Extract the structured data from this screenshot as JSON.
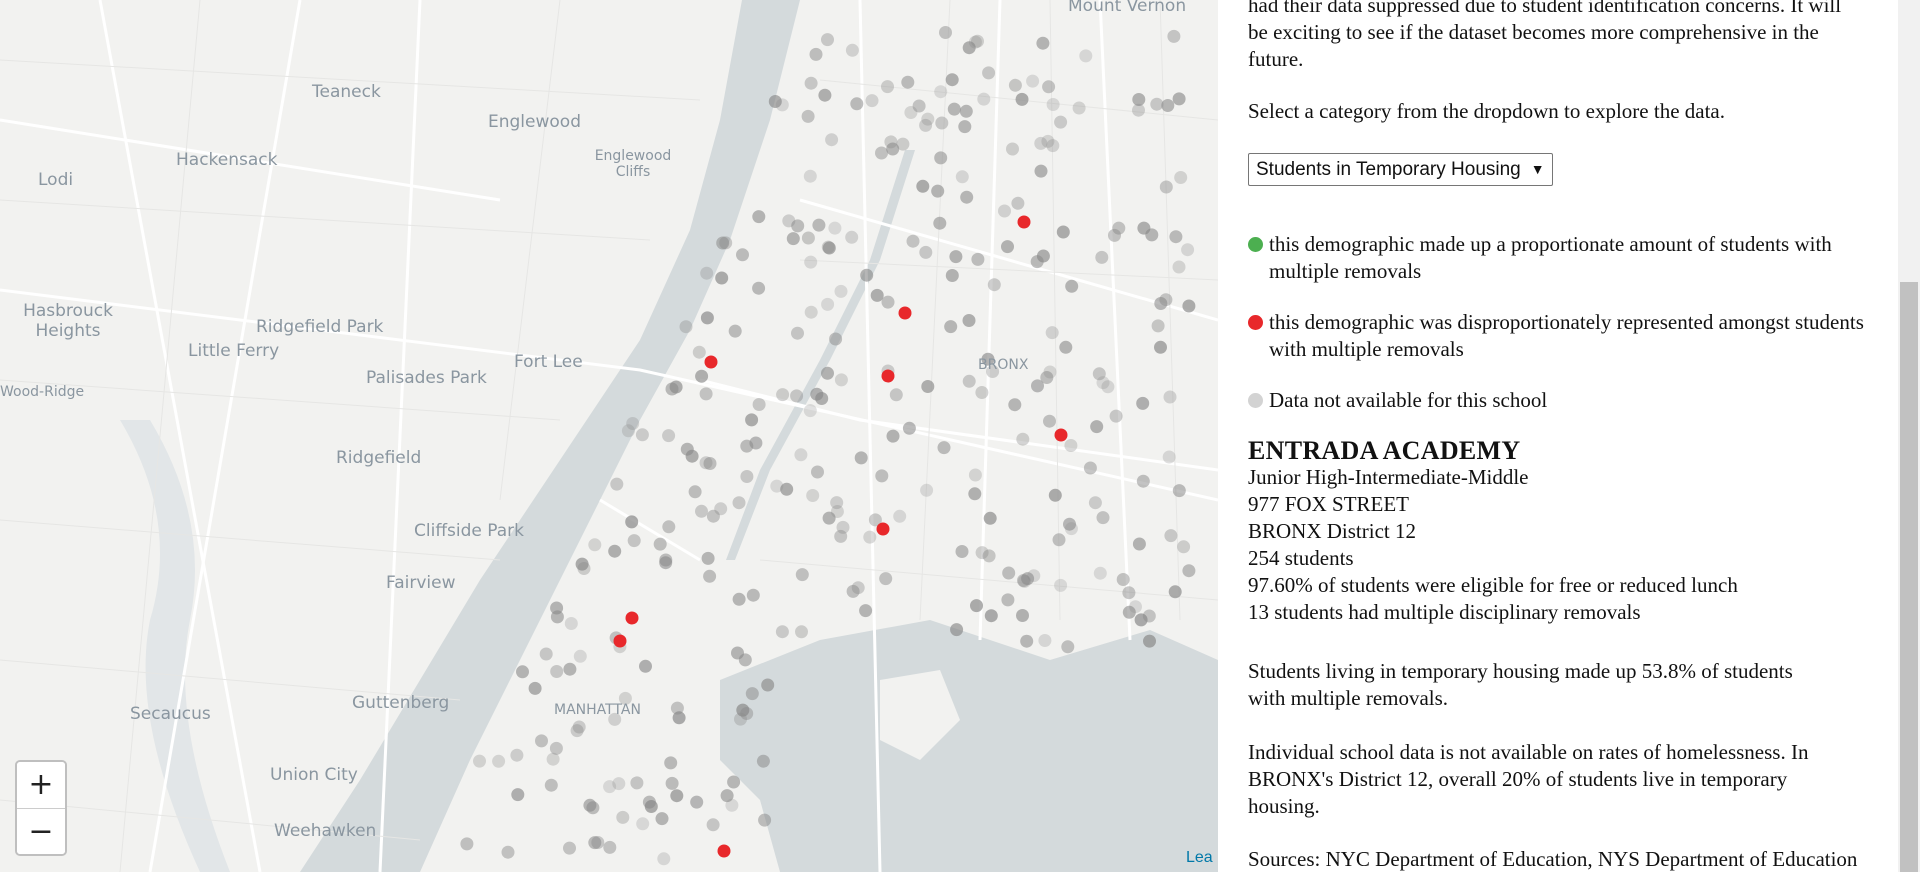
{
  "map": {
    "place_labels": [
      "Mount Vernon",
      "Teaneck",
      "Englewood",
      "Englewood Cliffs",
      "Hackensack",
      "Lodi",
      "Hasbrouck Heights",
      "Ridgefield Park",
      "Little Ferry",
      "Fort Lee",
      "Palisades Park",
      "Wood-Ridge",
      "BRONX",
      "Ridgefield",
      "Cliffside Park",
      "Fairview",
      "MANHATTAN",
      "Secaucus",
      "Guttenberg",
      "Union City",
      "Weehawken"
    ],
    "zoom_in_label": "+",
    "zoom_out_label": "−",
    "attribution": "Lea",
    "colors": {
      "water": "#d4dadc",
      "land": "#f2f2f0",
      "road": "#ffffff",
      "gray_dot": "#888888",
      "red_dot": "#e8282b"
    }
  },
  "panel": {
    "intro_tail": "had their data suppressed due to student identification concerns. It will be exciting to see if the dataset becomes more comprehensive in the future.",
    "instruction": "Select a category from the dropdown to explore the data.",
    "dropdown_value": "Students in Temporary Housing",
    "dropdown_arrow": "▼",
    "legend": [
      {
        "color": "#4caf50",
        "text": "this demographic made up a proportionate amount of students with multiple removals"
      },
      {
        "color": "#e8282b",
        "text": "this demographic was disproportionately represented amongst students with multiple removals"
      },
      {
        "color": "#d3d3d3",
        "text": "Data not available for this school"
      }
    ],
    "school": {
      "name": "ENTRADA ACADEMY",
      "type": "Junior High-Intermediate-Middle",
      "address": "977 FOX STREET",
      "district": "BRONX District 12",
      "students": "254 students",
      "lunch": "97.60% of students were eligible for free or reduced lunch",
      "removals": "13 students had multiple disciplinary removals",
      "stat": "Students living in temporary housing made up 53.8% of students with multiple removals.",
      "note": "Individual school data is not available on rates of homelessness. In BRONX's District 12, overall 20% of students live in temporary housing."
    },
    "sources": "Sources: NYC Department of Education, NYS Department of Education"
  }
}
